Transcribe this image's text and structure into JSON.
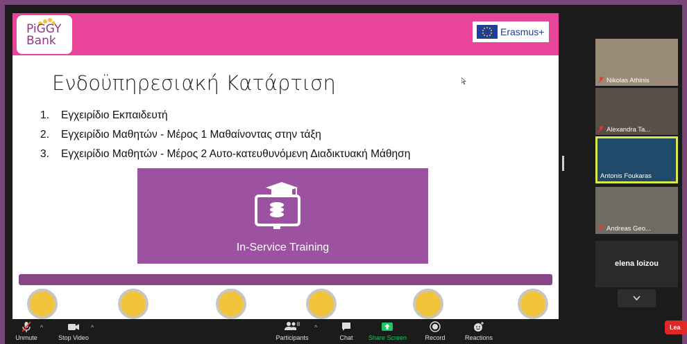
{
  "slide": {
    "logo_text": "PiGGY Bank",
    "logo_line1": "PiGGY",
    "logo_line2": "Bank",
    "erasmus_label": "Erasmus+",
    "title": "Ενδοϋπηρεσιακή Κατάρτιση",
    "items": [
      {
        "num": "1.",
        "text": "Εγχειρίδιο Εκπαιδευτή"
      },
      {
        "num": "2.",
        "text": "Εγχειρίδιο Μαθητών - Μέρος 1 Μαθαίνοντας στην τάξη"
      },
      {
        "num": "3.",
        "text": "Εγχειρίδιο Μαθητών - Μέρος 2 Αυτο-κατευθυνόμενη Διαδικτυακή Μάθηση"
      }
    ],
    "training_label": "In-Service Training",
    "colors": {
      "header": "#e8449a",
      "purple": "#9c52a0",
      "coin": "#f2c43a"
    }
  },
  "participants_panel": {
    "tiles": [
      {
        "name": "Nikolas Athinis",
        "muted": true
      },
      {
        "name": "Alexandra Ta...",
        "muted": true
      },
      {
        "name": "Antonis Foukaras",
        "muted": false,
        "active": true
      },
      {
        "name": "Andreas Geo...",
        "muted": true
      }
    ],
    "blank_tile_name": "elena loizou"
  },
  "toolbar": {
    "unmute": "Unmute",
    "stop_video": "Stop Video",
    "participants": "Participants",
    "participants_count": "8",
    "chat": "Chat",
    "share_screen": "Share Screen",
    "record": "Record",
    "reactions": "Reactions",
    "leave": "Lea"
  }
}
